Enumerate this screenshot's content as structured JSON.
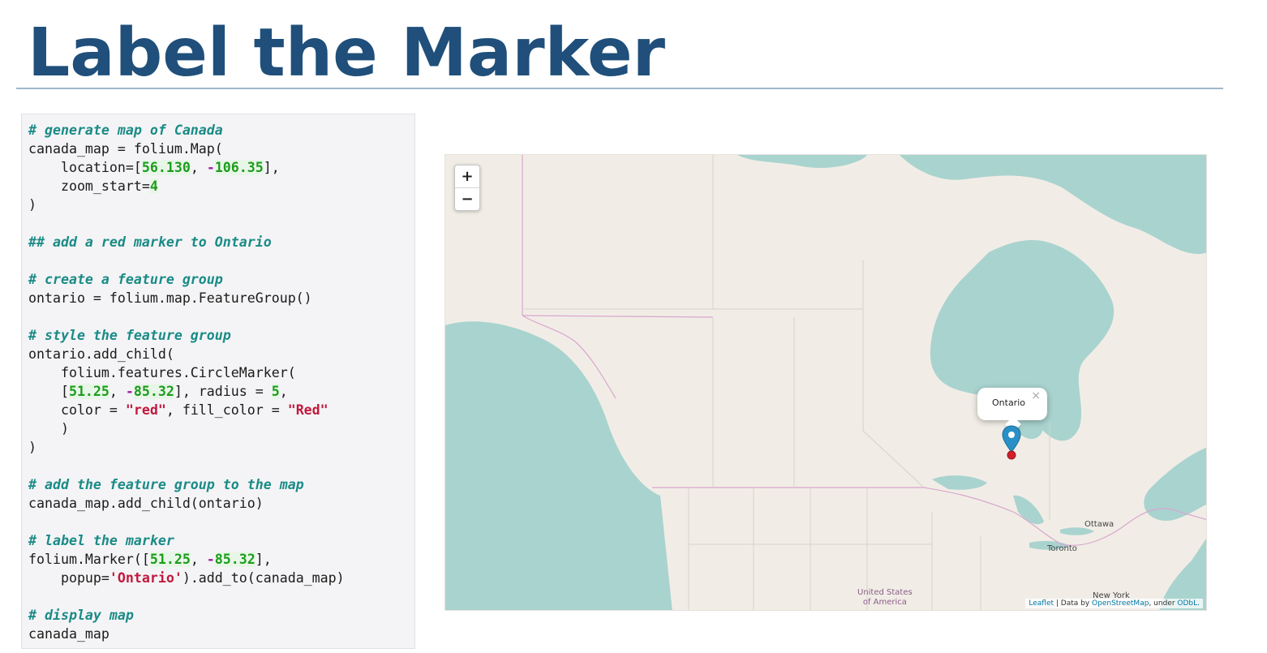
{
  "slide": {
    "title": "Label the Marker"
  },
  "code_lines": [
    [
      {
        "t": "cm",
        "v": "# generate map of Canada"
      }
    ],
    [
      {
        "t": "tx",
        "v": "canada_map = folium.Map("
      }
    ],
    [
      {
        "t": "tx",
        "v": "    location=["
      },
      {
        "t": "num",
        "v": "56.130"
      },
      {
        "t": "tx",
        "v": ", "
      },
      {
        "t": "op",
        "v": "-"
      },
      {
        "t": "num",
        "v": "106.35"
      },
      {
        "t": "tx",
        "v": "],"
      }
    ],
    [
      {
        "t": "tx",
        "v": "    zoom_start="
      },
      {
        "t": "num",
        "v": "4"
      }
    ],
    [
      {
        "t": "tx",
        "v": ")"
      }
    ],
    [],
    [
      {
        "t": "cm",
        "v": "## add a red marker to Ontario"
      }
    ],
    [],
    [
      {
        "t": "cm",
        "v": "# create a feature group"
      }
    ],
    [
      {
        "t": "tx",
        "v": "ontario = folium.map.FeatureGroup()"
      }
    ],
    [],
    [
      {
        "t": "cm",
        "v": "# style the feature group"
      }
    ],
    [
      {
        "t": "tx",
        "v": "ontario.add_child("
      }
    ],
    [
      {
        "t": "tx",
        "v": "    folium.features.CircleMarker("
      }
    ],
    [
      {
        "t": "tx",
        "v": "    ["
      },
      {
        "t": "num",
        "v": "51.25"
      },
      {
        "t": "tx",
        "v": ", "
      },
      {
        "t": "op",
        "v": "-"
      },
      {
        "t": "num",
        "v": "85.32"
      },
      {
        "t": "tx",
        "v": "], radius = "
      },
      {
        "t": "num",
        "v": "5"
      },
      {
        "t": "tx",
        "v": ","
      }
    ],
    [
      {
        "t": "tx",
        "v": "    color = "
      },
      {
        "t": "str",
        "v": "\"red\""
      },
      {
        "t": "tx",
        "v": ", fill_color = "
      },
      {
        "t": "str",
        "v": "\"Red\""
      }
    ],
    [
      {
        "t": "tx",
        "v": "    )"
      }
    ],
    [
      {
        "t": "tx",
        "v": ")"
      }
    ],
    [],
    [
      {
        "t": "cm",
        "v": "# add the feature group to the map"
      }
    ],
    [
      {
        "t": "tx",
        "v": "canada_map.add_child(ontario)"
      }
    ],
    [],
    [
      {
        "t": "cm",
        "v": "# label the marker"
      }
    ],
    [
      {
        "t": "tx",
        "v": "folium.Marker(["
      },
      {
        "t": "num",
        "v": "51.25"
      },
      {
        "t": "tx",
        "v": ", "
      },
      {
        "t": "op",
        "v": "-"
      },
      {
        "t": "num",
        "v": "85.32"
      },
      {
        "t": "tx",
        "v": "],"
      }
    ],
    [
      {
        "t": "tx",
        "v": "    popup="
      },
      {
        "t": "str",
        "v": "'Ontario'"
      },
      {
        "t": "tx",
        "v": ").add_to(canada_map)"
      }
    ],
    [],
    [
      {
        "t": "cm",
        "v": "# display map"
      }
    ],
    [
      {
        "t": "tx",
        "v": "canada_map"
      }
    ]
  ],
  "map": {
    "zoom_in": "+",
    "zoom_out": "−",
    "popup_text": "Ontario",
    "popup_close": "×",
    "cities": {
      "ottawa": "Ottawa",
      "toronto": "Toronto",
      "new_york": "New York"
    },
    "country_label_line1": "United States",
    "country_label_line2": "of America",
    "attribution": {
      "leaflet": "Leaflet",
      "middle": " | Data by ",
      "osm": "OpenStreetMap",
      "under": ", under ",
      "license": "ODbL."
    },
    "colors": {
      "land": "#f1ede6",
      "water": "#a9d3cf",
      "border": "#d9a6cf",
      "marker": "#2a8fc7",
      "circle": "#d21e2b"
    },
    "icons": {
      "marker": "map-pin-icon"
    }
  }
}
